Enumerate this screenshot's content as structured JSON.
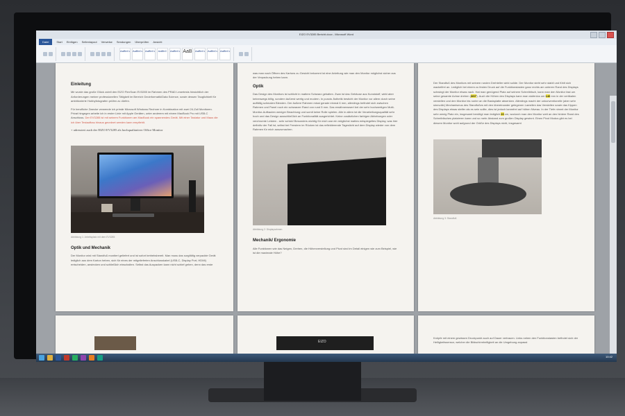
{
  "window": {
    "title": "EIZO EV3285 Bericht.docx - Microsoft Word",
    "tabs": [
      "Datei",
      "Start",
      "Einfügen",
      "Seitenlayout",
      "Verweise",
      "Sendungen",
      "Überprüfen",
      "Ansicht"
    ],
    "styles": [
      "AaBbCcI",
      "AaBbCcI",
      "AaBbCcI",
      "AaBbC",
      "AaBbCc",
      "AaB",
      "AaBbCcI",
      "AaBbCcI",
      "AaBbCcI"
    ]
  },
  "page1": {
    "heading": "Einleitung",
    "para1": "Mir wurde das große Glück zuteil den EIZO FlexScan EV3285 im Rahmen des PRAD Lesertests hinsichtlich der Anforderungen meiner professionellen Tätigkeit im Bereich Geoinformatik/Data Science, sowie dessen Tauglichkeit für ambitionierte Hobbyfotografen prüfen zu dürfen.",
    "para2": "Für berufliche Zwecke verwende ich primär Microsoft Windows Rechner in Kombination mit zwei 24-Zoll Monitoren. Privat hingegen arbeite ich in erster Linie mit Apple Geräten, unter anderem mit einem MacBook Pro mit USB-C Anschluss.",
    "para2_red": "Der EV3285 ist mit seinem Funktionen am MacBook ein spannendes Gerät. Mit einer Tastatur und Maus die ich über Testaufbau hinaus geordnet werden kann empfiehlt.",
    "serif_line": "+ adressiert auch der EIZO EV3285 als hochqualitativer Office Monitor",
    "caption": "Abbildung 1: Arbeitsplatz mit dem EV3285",
    "heading2": "Optik und Mechanik",
    "para3": "Der Monitor wird mit Standfuß montiert geliefert und ist sofort betriebsbereit. Man muss das sorgfältig verpackte Gerät lediglich aus dem Karton heben, sich für eines der mitgelieferten Anschlusskabel (USB-C, Display Port, HDMI) entscheiden, anstecken und schließlich einschalten. Selbst das Auspacken kann nicht schief gehen, denn das erste"
  },
  "page2": {
    "para1": "was man nach Öffnen des Kartons zu Gesicht bekommt ist eine Anleitung wie man den Monitor möglichst sicher aus der Verpackung heben kann.",
    "heading": "Optik",
    "para2": "Das Design des Monitors ist schlicht in mattem Schwarz gehalten. Zwar ist das Gehäuse aus Kunststoff, wirkt aber keineswegs billig, sondern äußerst wertig und modern. In puncto Ästhetik besticht der Monitor vor allem durch seine auffällig schmalen Blenden. Der äußere Rahmen misst gerade einmal 6 mm, allerdings befindet sich zwischen Rahmen und Panel noch ein schwarzer Rand von rund 5 mm. Das erwähnenswert bei der sehr hochwertigen Multi-Monitor-Aufbauten weniger Beachtung und somit keine Rolle spielen. Alle in allem ist die Verarbeitungsqualität sehr hoch und das Design ausschließlich an Funktionalität ausgerichtet. Keine zusätzlichen farbigen Abhebungen oder verchromte Leisten - sehr schick! Besonders wichtig für mich war ein möglichst mattes entspiegeltes Display, was hier definitiv der Fall ist, selbst bei Fenstern im Rücken ist das reflektierende Tageslicht auf dem Display wieder von dem Rahmen für mich auszumachen.",
    "caption": "Abbildung 2: Displayrahmen",
    "heading2": "Mechanik/ Ergonomie",
    "para3": "Alle Funktionen wie das Neigen, Drehen, die Höhenverstellung und Pivot sind im Detail einigen wie zum Beispiel, wie ist die maximale Höhe?"
  },
  "page3": {
    "para1_a": "Der Standfuß des Monitors mit seinem runden Drehteller wirkt solide. Der Monitor steht sehr stabil und fühlt sich wackelfrei an. Lediglich bei einem zu festen Druck auf die Funktionstasten ganz rechts am unteren Rand des Displays schwingt der Monitor etwas nach. Hat man genügend Platz auf seinem Schreibtisch, kann man den Monitor fast um seine gesamte Achse drehen (",
    "hl1": "360°",
    "para1_b": "). Auch die Höhen des Displays kann man stufenlos um",
    "hl2": "140",
    "para1_c": "mm in der vertikalen verstellen und den Monitor bis runter an die Basisplatte absenken. Allerdings macht der unkonventionelle (aber sehr sinnvolle) Mechanismus des Standfußes mit den übereinander gelegenen Lamellen das Verstellen sowie das Kippen des Displays etwas steifer als es sein sollte, dies ist jedoch lammfrei auf höhen Niveau. In der Tiefe nimmt der Monitor sehr wenig Platz ein, insgesamt benötigt man lediglich",
    "hl3": "23",
    "para1_d": "cm, wodurch man den Monitor weit an den hintere Rand des Schreibtisches platzieren kann und so mehr Abstand zum großen Display gewinnt. Einen Pivot Modus gibt es bei diesem Monitor wohl aufgrund der Größe des Displays nicht, insgesamt",
    "caption": "Abbildung 3: Standfuß"
  },
  "page6": {
    "para1": "Knöpfe mit einem gewissen Druckpunkt auch auf Dauer vertrauen. Links neben den Funktionstasten befindet sich der Helligkeitssensor, welcher die Bildschirmhelligkeit an die Umgebung anpasst"
  },
  "page5": {
    "logo": "EIZO"
  },
  "taskbar": {
    "time": "10:42"
  }
}
